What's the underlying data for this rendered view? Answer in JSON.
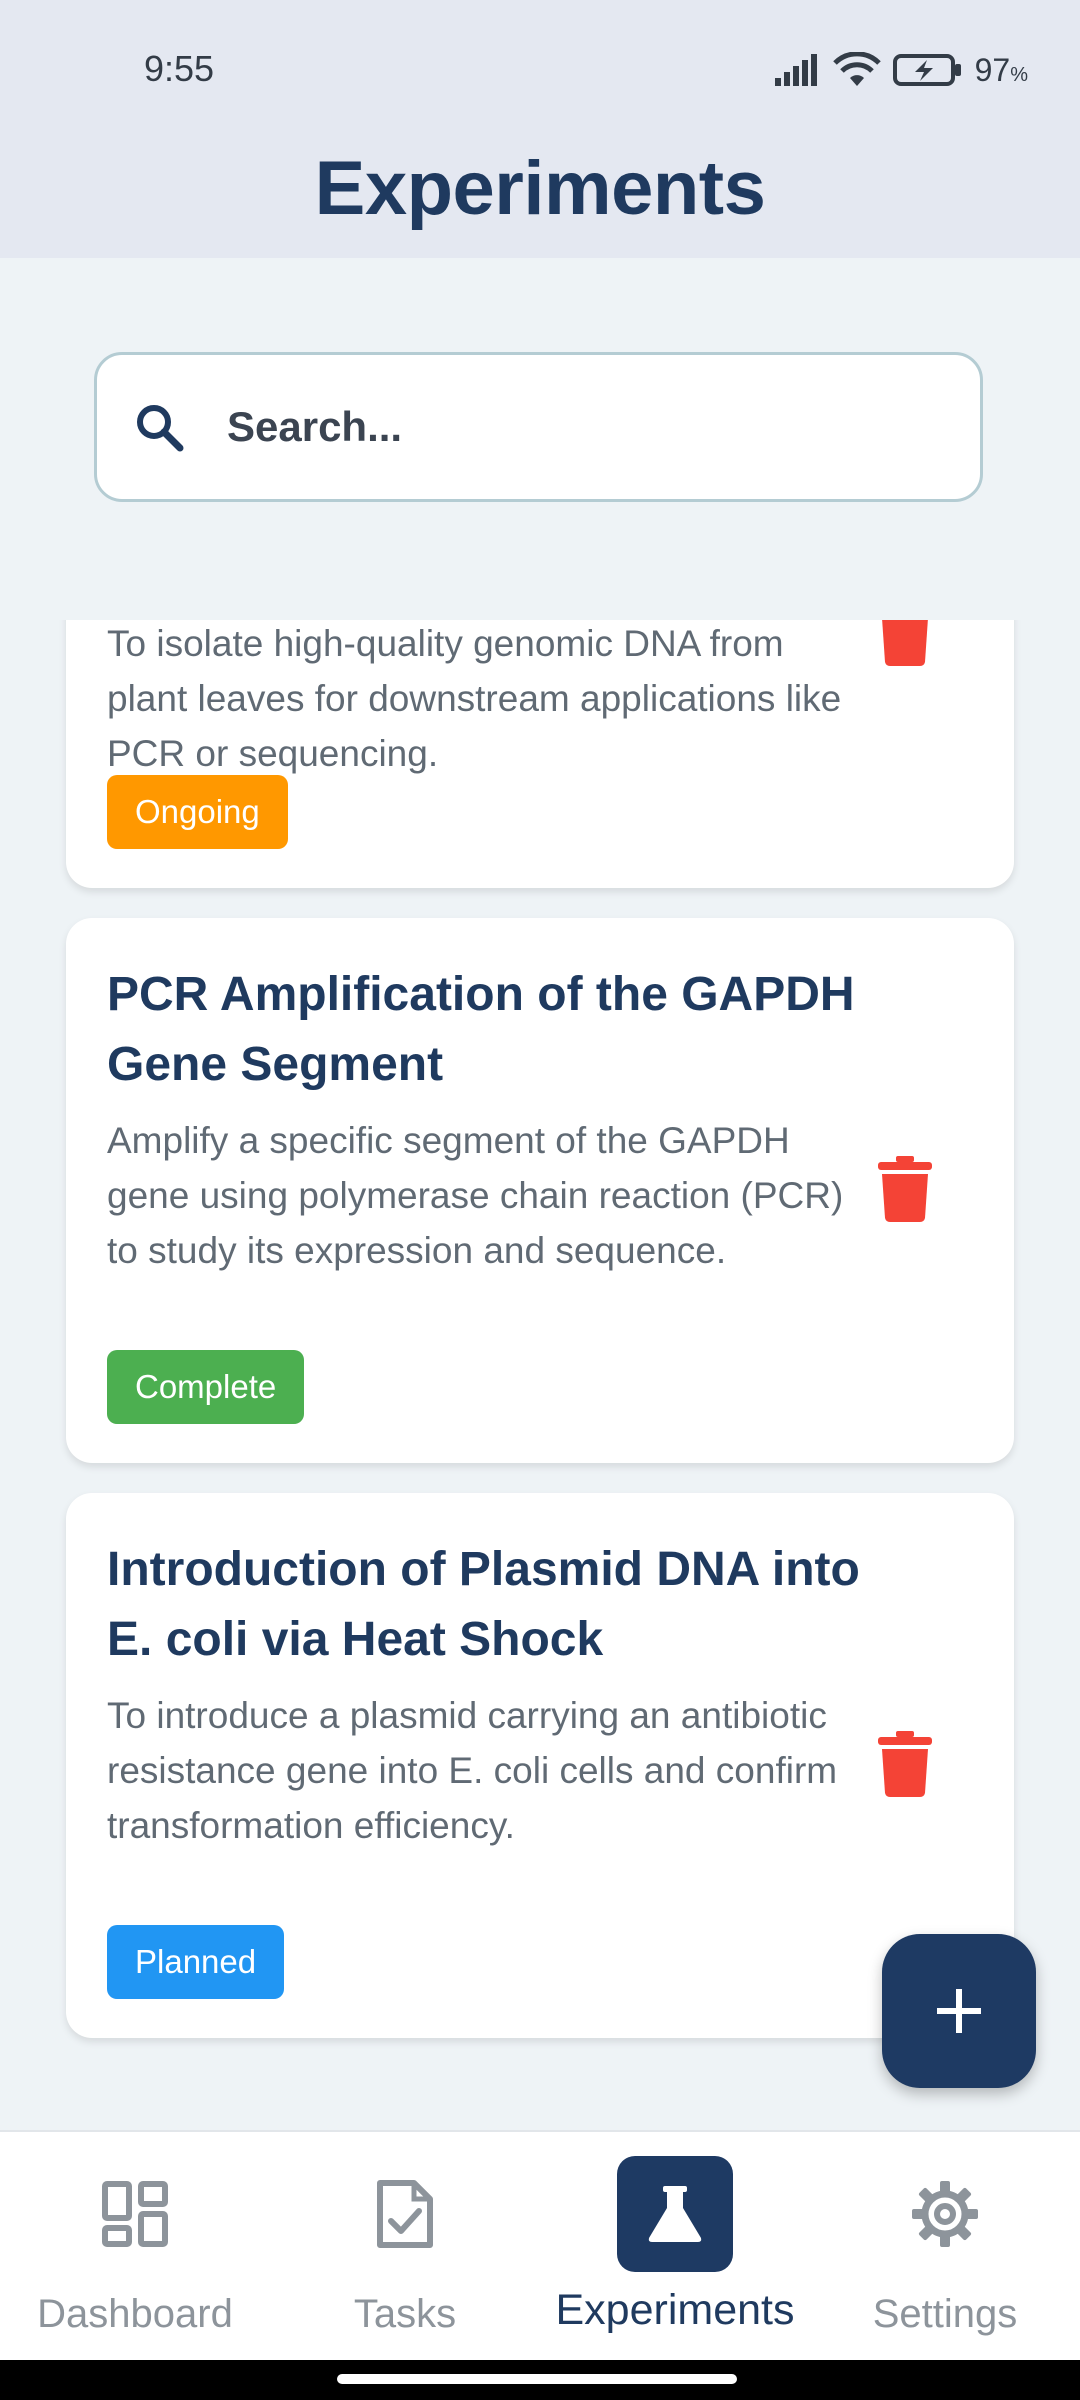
{
  "status_bar": {
    "time": "9:55",
    "battery": "97",
    "battery_unit": "%",
    "icons": [
      "signal-icon",
      "wifi-icon",
      "battery-charging-icon"
    ]
  },
  "header": {
    "title": "Experiments"
  },
  "search": {
    "placeholder": "Search...",
    "value": ""
  },
  "colors": {
    "primary": "#1e3a63",
    "ongoing": "#ff9800",
    "complete": "#4caf50",
    "planned": "#2196f3",
    "delete": "#f44336"
  },
  "experiments": [
    {
      "title": "",
      "description": "To isolate high-quality genomic DNA from plant leaves for downstream applications like PCR or sequencing.",
      "status": "Ongoing"
    },
    {
      "title": "PCR Amplification of the GAPDH Gene Segment",
      "description": "Amplify a specific segment of the GAPDH gene using polymerase chain reaction (PCR) to study its expression and sequence.",
      "status": "Complete"
    },
    {
      "title": "Introduction of Plasmid DNA into E. coli via Heat Shock",
      "description": "To introduce a plasmid carrying an antibiotic resistance gene into E. coli cells and confirm transformation efficiency.",
      "status": "Planned"
    }
  ],
  "fab": {
    "icon": "plus-icon"
  },
  "bottom_nav": [
    {
      "label": "Dashboard",
      "icon": "dashboard-icon",
      "active": false
    },
    {
      "label": "Tasks",
      "icon": "task-check-icon",
      "active": false
    },
    {
      "label": "Experiments",
      "icon": "flask-icon",
      "active": true
    },
    {
      "label": "Settings",
      "icon": "gear-icon",
      "active": false
    }
  ]
}
